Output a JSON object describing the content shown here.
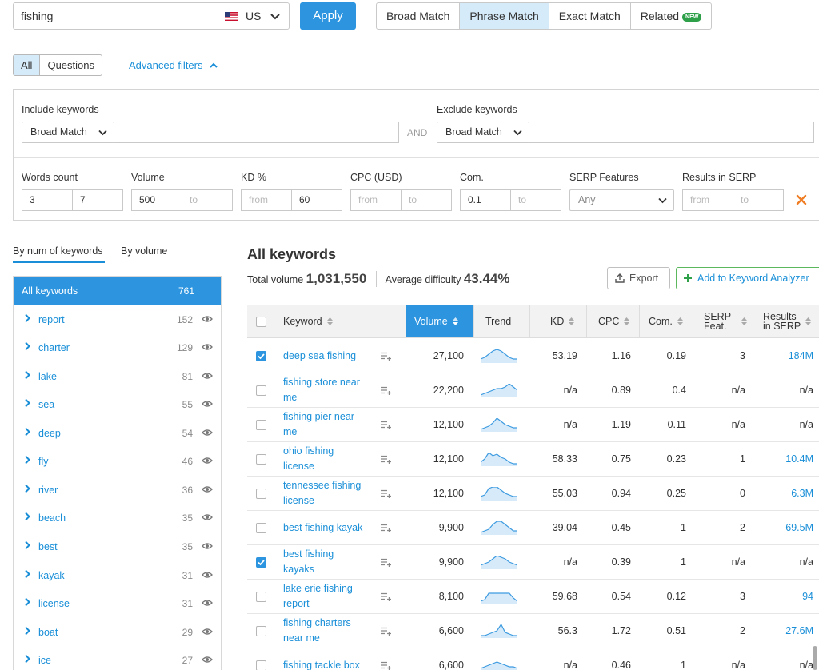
{
  "search": {
    "query": "fishing",
    "country": "US",
    "apply_label": "Apply"
  },
  "match_tabs": [
    {
      "label": "Broad Match",
      "active": false
    },
    {
      "label": "Phrase Match",
      "active": true
    },
    {
      "label": "Exact Match",
      "active": false
    },
    {
      "label": "Related",
      "active": false,
      "badge": "NEW"
    }
  ],
  "type_tabs": {
    "all": "All",
    "questions": "Questions"
  },
  "advanced_filters_label": "Advanced filters",
  "filters": {
    "include_label": "Include keywords",
    "include_match": "Broad Match",
    "and_label": "AND",
    "exclude_label": "Exclude keywords",
    "exclude_match": "Broad Match",
    "words_count": {
      "label": "Words count",
      "from": "3",
      "to": "7"
    },
    "volume": {
      "label": "Volume",
      "from": "500",
      "to_placeholder": "to"
    },
    "kd": {
      "label": "KD %",
      "from_placeholder": "from",
      "to": "60"
    },
    "cpc": {
      "label": "CPC (USD)",
      "from_placeholder": "from",
      "to_placeholder": "to"
    },
    "com": {
      "label": "Com.",
      "from": "0.1",
      "to_placeholder": "to"
    },
    "serp_features": {
      "label": "SERP Features",
      "value": "Any"
    },
    "results_in_serp": {
      "label": "Results in SERP",
      "from_placeholder": "from",
      "to_placeholder": "to"
    }
  },
  "group_tabs": {
    "by_num": "By num of keywords",
    "by_volume": "By volume"
  },
  "groups": [
    {
      "label": "All keywords",
      "count": "761"
    },
    {
      "label": "report",
      "count": "152"
    },
    {
      "label": "charter",
      "count": "129"
    },
    {
      "label": "lake",
      "count": "81"
    },
    {
      "label": "sea",
      "count": "55"
    },
    {
      "label": "deep",
      "count": "54"
    },
    {
      "label": "fly",
      "count": "46"
    },
    {
      "label": "river",
      "count": "36"
    },
    {
      "label": "beach",
      "count": "35"
    },
    {
      "label": "best",
      "count": "35"
    },
    {
      "label": "kayak",
      "count": "31"
    },
    {
      "label": "license",
      "count": "31"
    },
    {
      "label": "boat",
      "count": "29"
    },
    {
      "label": "ice",
      "count": "27"
    }
  ],
  "main": {
    "title": "All keywords",
    "total_volume_label": "Total volume",
    "total_volume": "1,031,550",
    "avg_difficulty_label": "Average difficulty",
    "avg_difficulty": "43.44%",
    "export_label": "Export",
    "add_label": "Add to Keyword Analyzer"
  },
  "columns": {
    "keyword": "Keyword",
    "volume": "Volume",
    "trend": "Trend",
    "kd": "KD",
    "cpc": "CPC",
    "com": "Com.",
    "serp_1": "SERP",
    "serp_2": "Feat.",
    "results_1": "Results",
    "results_2": "in SERP"
  },
  "rows": [
    {
      "kw1": "deep sea fishing",
      "kw2": "",
      "checked": true,
      "volume": "27,100",
      "kd": "53.19",
      "cpc": "1.16",
      "com": "0.19",
      "serp": "3",
      "results": "184M",
      "results_link": true,
      "trend": [
        2,
        3,
        5,
        7,
        8,
        7,
        5,
        3,
        2,
        2
      ]
    },
    {
      "kw1": "fishing store near",
      "kw2": "me",
      "checked": false,
      "volume": "22,200",
      "kd": "n/a",
      "cpc": "0.89",
      "com": "0.4",
      "serp": "n/a",
      "results": "n/a",
      "results_link": false,
      "trend": [
        1,
        2,
        3,
        4,
        5,
        5,
        6,
        8,
        6,
        4
      ]
    },
    {
      "kw1": "fishing pier near",
      "kw2": "me",
      "checked": false,
      "volume": "12,100",
      "kd": "n/a",
      "cpc": "1.19",
      "com": "0.11",
      "serp": "n/a",
      "results": "n/a",
      "results_link": false,
      "trend": [
        1,
        2,
        3,
        5,
        8,
        6,
        4,
        3,
        2,
        2
      ]
    },
    {
      "kw1": "ohio fishing",
      "kw2": "license",
      "checked": false,
      "volume": "12,100",
      "kd": "58.33",
      "cpc": "0.75",
      "com": "0.23",
      "serp": "1",
      "results": "10.4M",
      "results_link": true,
      "trend": [
        2,
        4,
        8,
        6,
        7,
        5,
        4,
        2,
        1,
        1
      ]
    },
    {
      "kw1": "tennessee fishing",
      "kw2": "license",
      "checked": false,
      "volume": "12,100",
      "kd": "55.03",
      "cpc": "0.94",
      "com": "0.25",
      "serp": "0",
      "results": "6.3M",
      "results_link": true,
      "trend": [
        2,
        3,
        7,
        8,
        8,
        6,
        4,
        3,
        2,
        2
      ]
    },
    {
      "kw1": "best fishing kayak",
      "kw2": "",
      "checked": false,
      "volume": "9,900",
      "kd": "39.04",
      "cpc": "0.45",
      "com": "1",
      "serp": "2",
      "results": "69.5M",
      "results_link": true,
      "trend": [
        1,
        2,
        3,
        6,
        8,
        8,
        6,
        4,
        2,
        2
      ]
    },
    {
      "kw1": "best fishing",
      "kw2": "kayaks",
      "checked": true,
      "volume": "9,900",
      "kd": "n/a",
      "cpc": "0.39",
      "com": "1",
      "serp": "n/a",
      "results": "n/a",
      "results_link": false,
      "trend": [
        2,
        3,
        4,
        6,
        8,
        7,
        6,
        4,
        3,
        2
      ]
    },
    {
      "kw1": "lake erie fishing",
      "kw2": "report",
      "checked": false,
      "volume": "8,100",
      "kd": "59.68",
      "cpc": "0.54",
      "com": "0.12",
      "serp": "3",
      "results": "94",
      "results_link": true,
      "trend": [
        1,
        2,
        6,
        6,
        6,
        6,
        6,
        6,
        3,
        1
      ]
    },
    {
      "kw1": "fishing charters",
      "kw2": "near me",
      "checked": false,
      "volume": "6,600",
      "kd": "56.3",
      "cpc": "1.72",
      "com": "0.51",
      "serp": "2",
      "results": "27.6M",
      "results_link": true,
      "trend": [
        1,
        1,
        2,
        3,
        4,
        8,
        3,
        2,
        1,
        1
      ]
    },
    {
      "kw1": "fishing tackle box",
      "kw2": "",
      "checked": false,
      "volume": "6,600",
      "kd": "n/a",
      "cpc": "0.46",
      "com": "1",
      "serp": "n/a",
      "results": "n/a",
      "results_link": false,
      "trend": [
        2,
        3,
        4,
        5,
        6,
        5,
        4,
        3,
        3,
        2
      ]
    }
  ]
}
